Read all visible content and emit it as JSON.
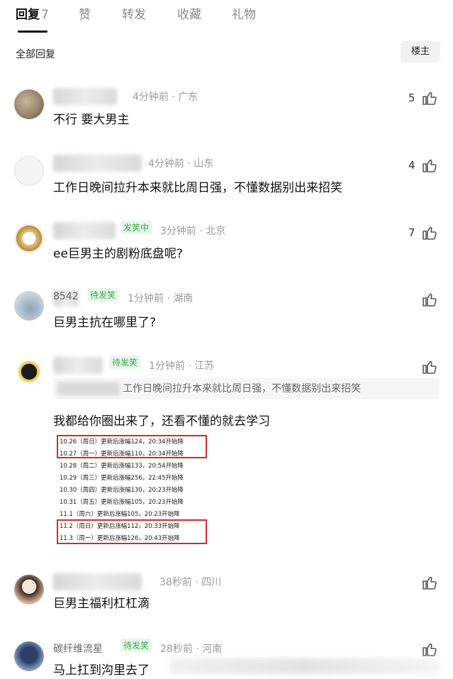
{
  "tabs": [
    {
      "label": "回复",
      "count": "7"
    },
    {
      "label": "赞"
    },
    {
      "label": "转发"
    },
    {
      "label": "收藏"
    },
    {
      "label": "礼物"
    }
  ],
  "subheader": {
    "title": "全部回复",
    "owner_button": "楼主"
  },
  "comments": [
    {
      "badge": "",
      "time_location": "4分钟前 · 广东",
      "text": "不行 要大男主",
      "likes": "5"
    },
    {
      "badge": "",
      "time_location": "4分钟前 · 山东",
      "text": "工作日晚间拉升本来就比周日强，不懂数据别出来招笑",
      "likes": "4"
    },
    {
      "badge": "发笑中",
      "time_location": "3分钟前 · 北京",
      "text": "ee巨男主的剧粉底盘呢?",
      "likes": "7"
    },
    {
      "badge": "待发笑",
      "name_fragment": "8542",
      "time_location": "1分钟前 · 湖南",
      "text": "巨男主抗在哪里了?",
      "likes": ""
    },
    {
      "badge": "待发笑",
      "time_location": "1分钟前 · 江苏",
      "quote": "工作日晚间拉升本来就比周日强，不懂数据别出来招笑",
      "text": "我都给你圈出来了，还看不懂的就去学习",
      "likes": "",
      "embed_lines": [
        "10.26（周日）更新后涨幅124，20:34开始降",
        "10.27（周一）更新后涨幅110，20:34开始降",
        "10.28（周二）更新后涨幅133，20:54开始降",
        "10.29（周三）更新后涨幅256，22:45开始降",
        "10.30（周四）更新后涨幅130，20:23开始降",
        "10.31（周五）更新后涨幅105，20:23开始降",
        "11.1（周六）更新后涨幅105，20:23开始降",
        "11.2（周日）更新后涨幅112，20:33开始降",
        "11.3（周一）更新后涨幅126，20:43开始降"
      ]
    },
    {
      "badge": "",
      "time_location": "38秒前 · 四川",
      "text": "巨男主福利杠杠滴",
      "likes": ""
    },
    {
      "badge": "待发笑",
      "name_fragment": "碳纤维流星",
      "time_location": "28秒前 · 河南",
      "text": "马上扛到沟里去了",
      "likes": ""
    }
  ],
  "colors": {
    "badge_green": "#3aa84d",
    "highlight_red": "#c9302c",
    "meta_gray": "#999999"
  }
}
